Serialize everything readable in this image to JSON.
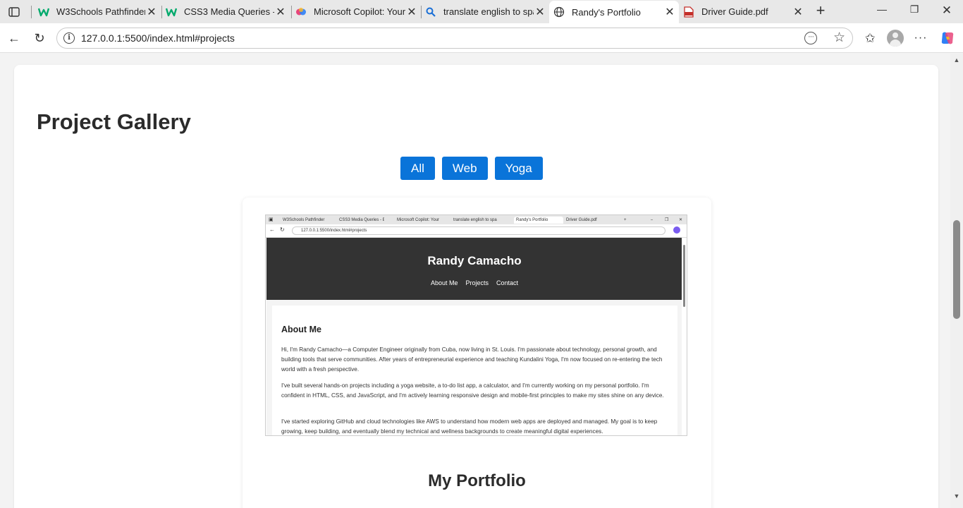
{
  "browser": {
    "tabs": [
      {
        "title": "W3Schools Pathfinder",
        "icon": "w3schools-icon"
      },
      {
        "title": "CSS3 Media Queries - E",
        "icon": "w3schools-icon"
      },
      {
        "title": "Microsoft Copilot: Your",
        "icon": "copilot-icon"
      },
      {
        "title": "translate english to spa",
        "icon": "search-icon"
      },
      {
        "title": "Randy's Portfolio",
        "icon": "globe-icon",
        "active": true
      },
      {
        "title": "Driver Guide.pdf",
        "icon": "pdf-icon"
      }
    ],
    "url": "127.0.0.1:5500/index.html#projects"
  },
  "gallery": {
    "title": "Project Gallery",
    "filters": [
      "All",
      "Web",
      "Yoga"
    ],
    "accent_color": "#0a74d9"
  },
  "project": {
    "thumbnail": {
      "tabs": [
        "W3Schools Pathfinder",
        "CSS3 Media Queries - E",
        "Microsoft Copilot: Your",
        "translate english to spa",
        "Randy's Portfolio",
        "Driver Guide.pdf"
      ],
      "url": "127.0.0.1:5500/index.html#projects",
      "site_name": "Randy Camacho",
      "nav": [
        "About Me",
        "Projects",
        "Contact"
      ],
      "section_title": "About Me",
      "paragraphs": [
        "Hi, I'm Randy Camacho—a Computer Engineer originally from Cuba, now living in St. Louis. I'm passionate about technology, personal growth, and building tools that serve communities. After years of entrepreneurial experience and teaching Kundalini Yoga, I'm now focused on re-entering the tech world with a fresh perspective.",
        "I've built several hands-on projects including a yoga website, a to-do list app, a calculator, and I'm currently working on my personal portfolio. I'm confident in HTML, CSS, and JavaScript, and I'm actively learning responsive design and mobile-first principles to make my sites shine on any device.",
        "I've started exploring GitHub and cloud technologies like AWS to understand how modern web apps are deployed and managed. My goal is to keep growing, keep building, and eventually blend my technical and wellness backgrounds to create meaningful digital experiences."
      ]
    },
    "title": "My Portfolio"
  }
}
